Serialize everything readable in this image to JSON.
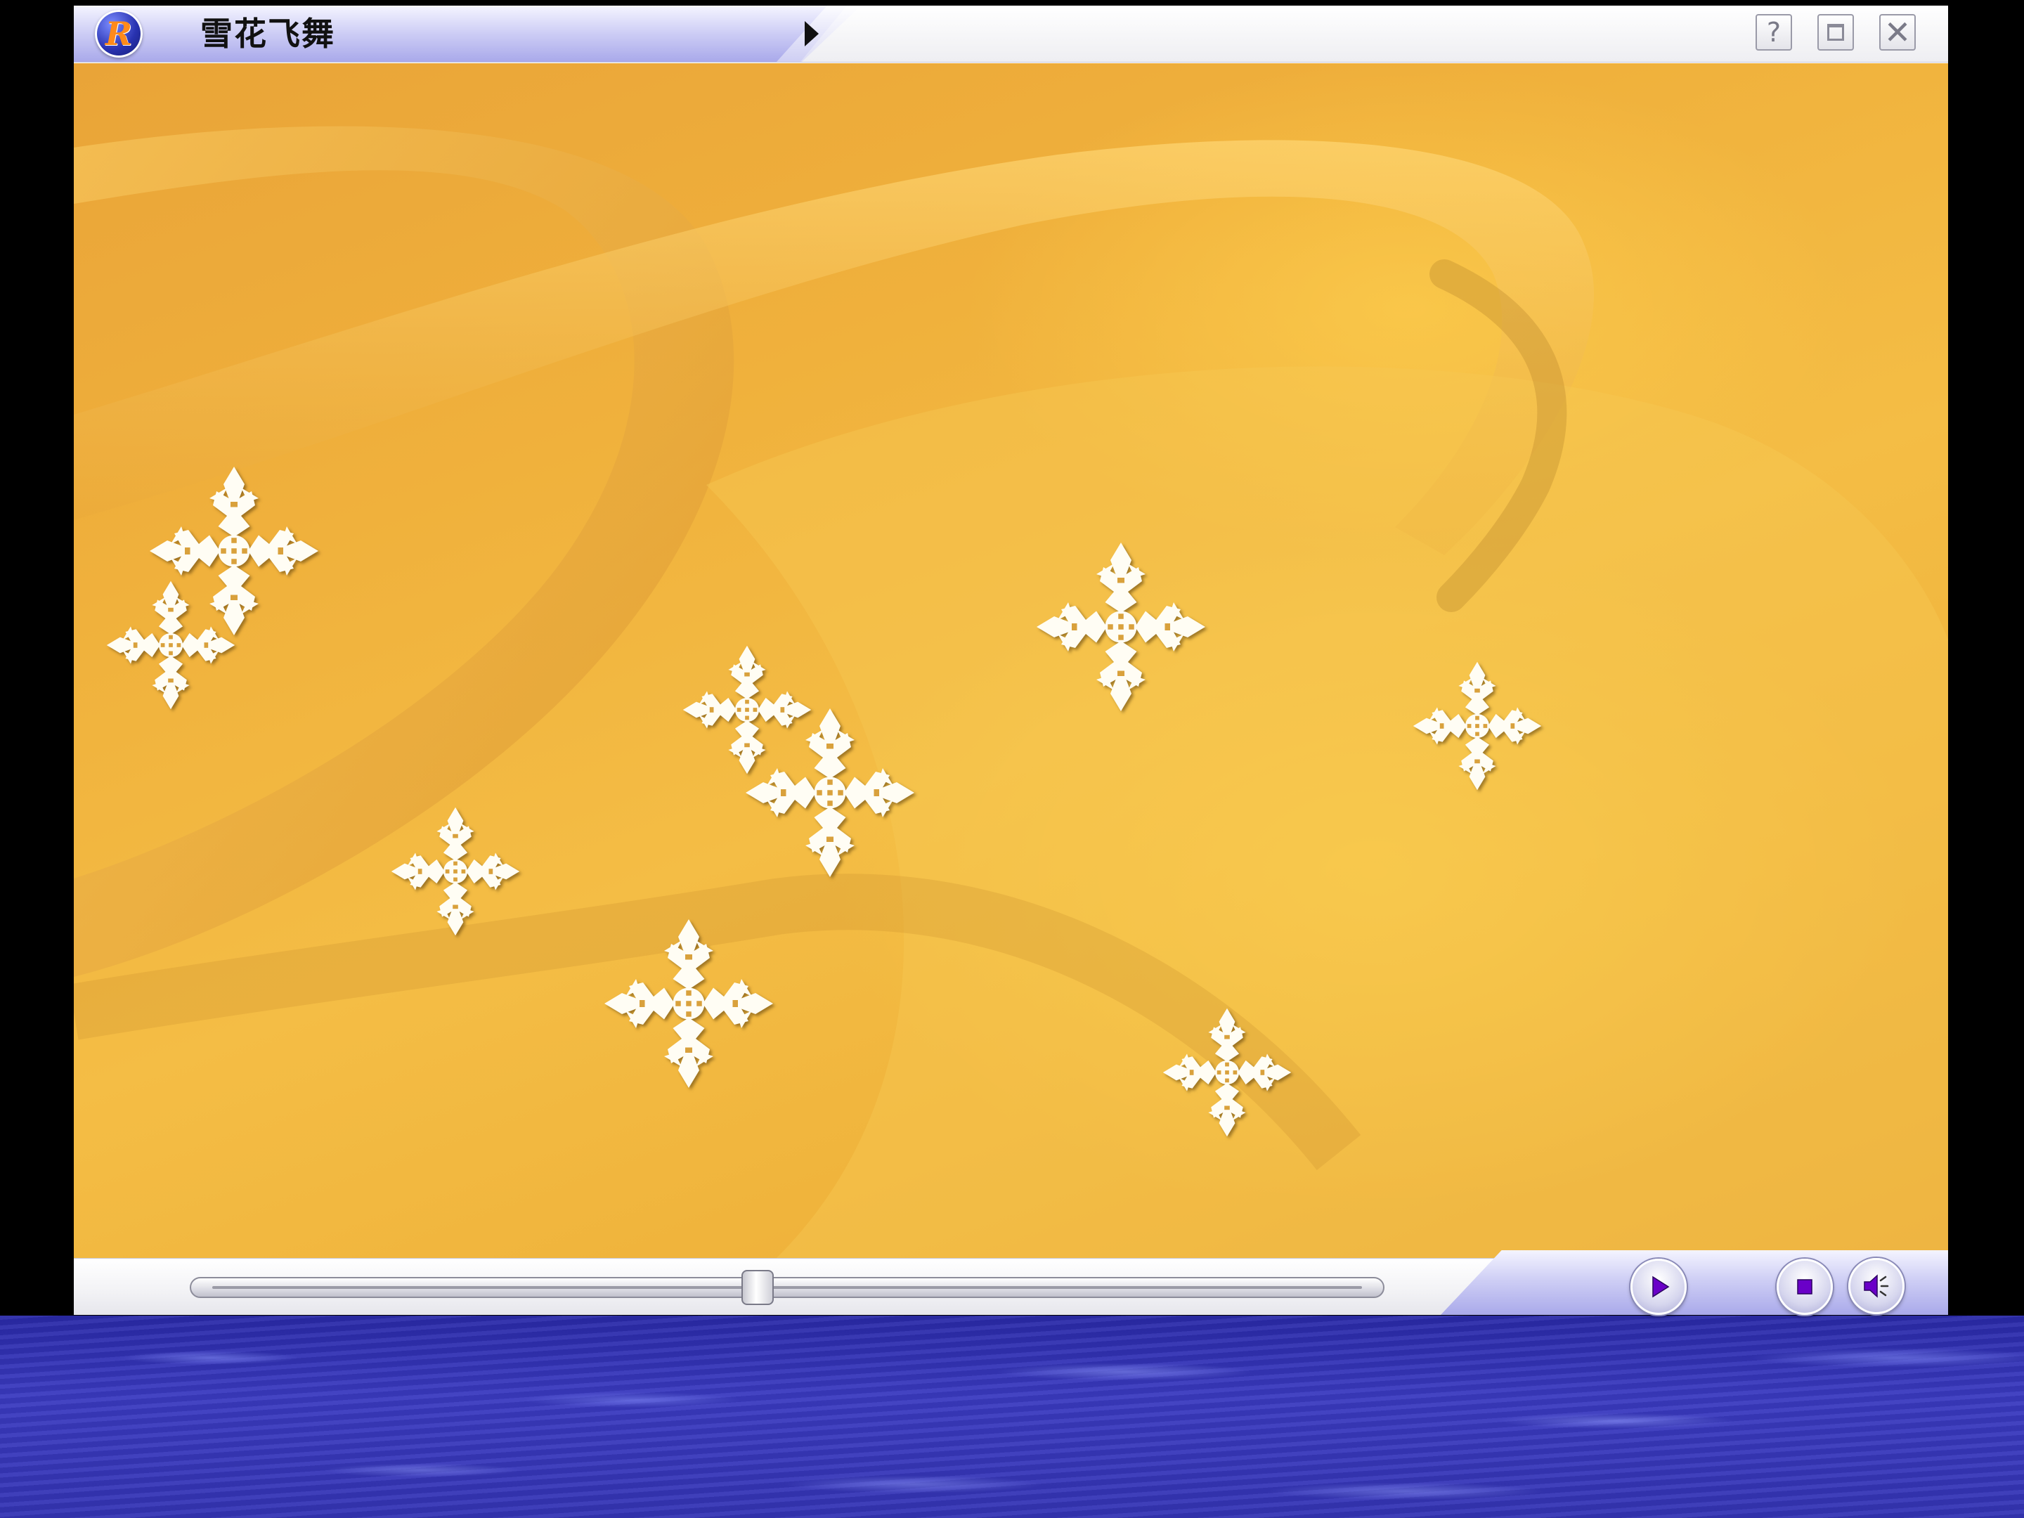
{
  "window": {
    "title": "雪花飞舞",
    "logo_letter": "R",
    "help_label": "?",
    "close_label": "✕"
  },
  "icons": {
    "logo": "player-logo-icon",
    "menu": "play-triangle-icon",
    "help": "help-icon",
    "maximize": "maximize-icon",
    "close": "close-icon",
    "play": "play-icon",
    "stop": "stop-icon",
    "volume": "speaker-icon",
    "flake": "snowflake-icon"
  },
  "playback": {
    "seek_progress": 0.475
  },
  "colors": {
    "accent": "#6a00c8",
    "panel": "#b5b5ee",
    "background_gold": "#f0b13c",
    "water": "#3434b4"
  }
}
